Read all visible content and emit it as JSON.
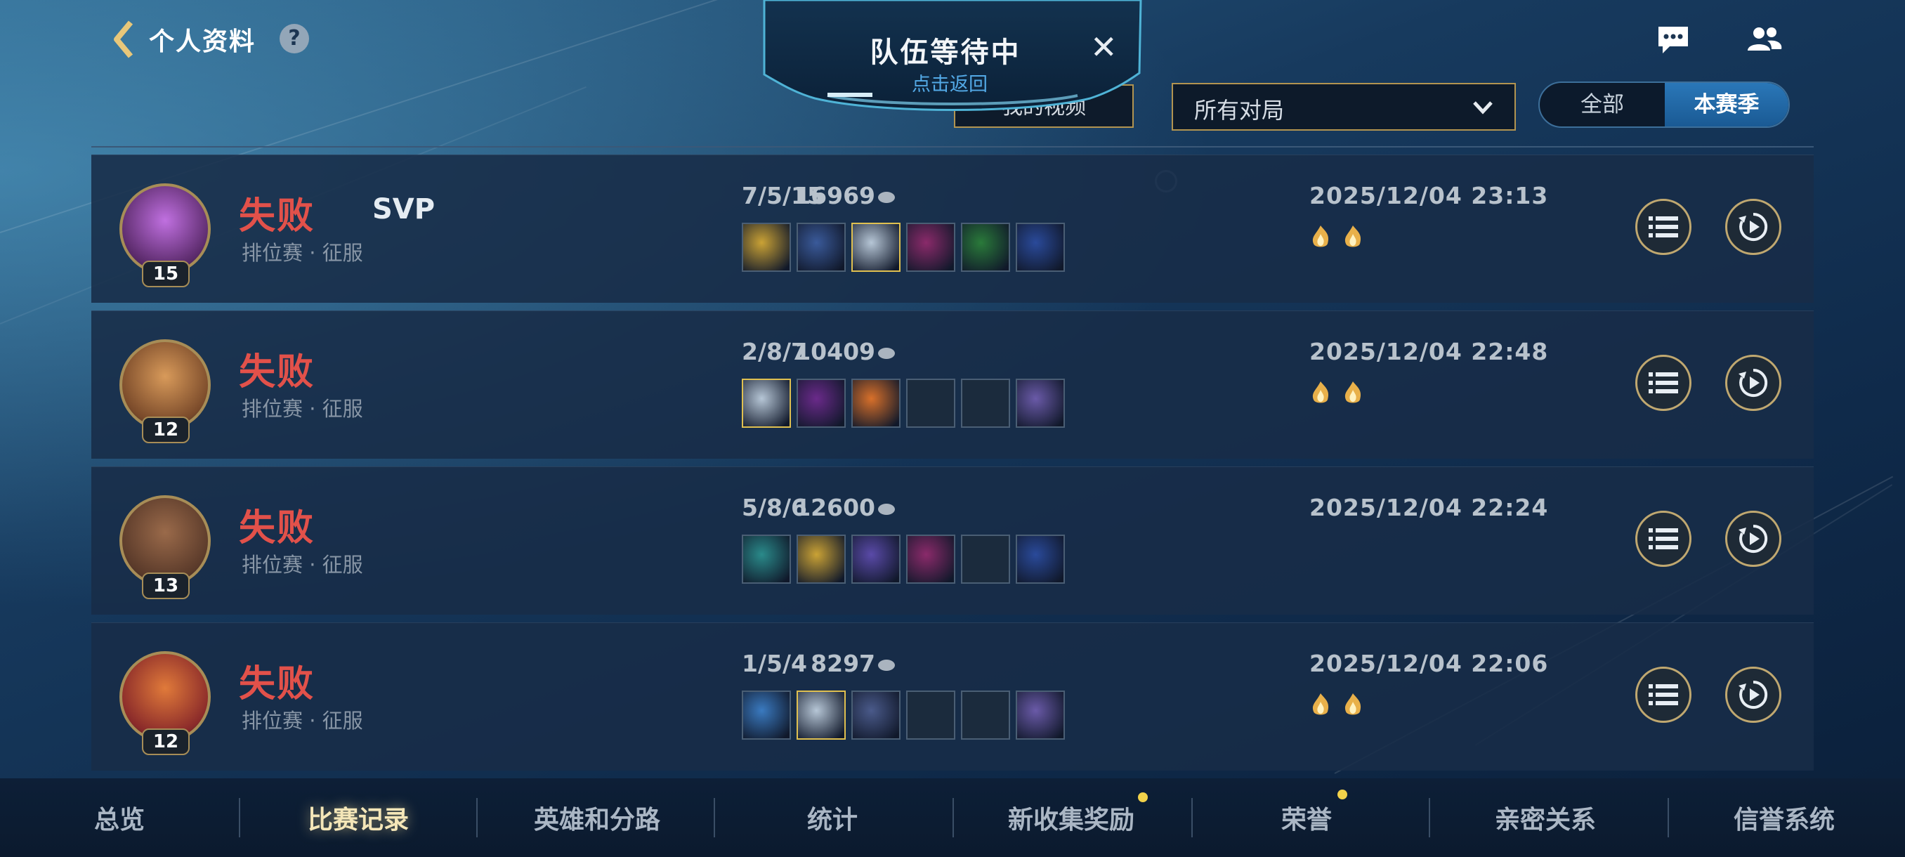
{
  "header": {
    "title": "个人资料",
    "help": "?"
  },
  "queue": {
    "title": "队伍等待中",
    "subtitle": "点击返回",
    "close": "✕"
  },
  "filters": {
    "video_button": "我的视频",
    "match_select": "所有对局",
    "seg_all": "全部",
    "seg_season": "本赛季"
  },
  "matches": [
    {
      "level": "15",
      "result": "失败",
      "svp": "SVP",
      "mode": "排位赛 · 征服",
      "kda": "7/5/15",
      "gold": "16969",
      "date": "2025/12/04 23:13",
      "badges": 2
    },
    {
      "level": "12",
      "result": "失败",
      "svp": "",
      "mode": "排位赛 · 征服",
      "kda": "2/8/7",
      "gold": "10409",
      "date": "2025/12/04 22:48",
      "badges": 2
    },
    {
      "level": "13",
      "result": "失败",
      "svp": "",
      "mode": "排位赛 · 征服",
      "kda": "5/8/6",
      "gold": "12600",
      "date": "2025/12/04 22:24",
      "badges": 0
    },
    {
      "level": "12",
      "result": "失败",
      "svp": "",
      "mode": "排位赛 · 征服",
      "kda": "1/5/4",
      "gold": "8297",
      "date": "2025/12/04 22:06",
      "badges": 2
    }
  ],
  "nav": {
    "items": [
      "总览",
      "比赛记录",
      "英雄和分路",
      "统计",
      "新收集奖励",
      "荣誉",
      "亲密关系",
      "信誉系统"
    ],
    "active_index": 1
  },
  "colors": {
    "defeat": "#e2514a",
    "gold_border": "#b29450",
    "accent_blue": "#53a9e6"
  }
}
